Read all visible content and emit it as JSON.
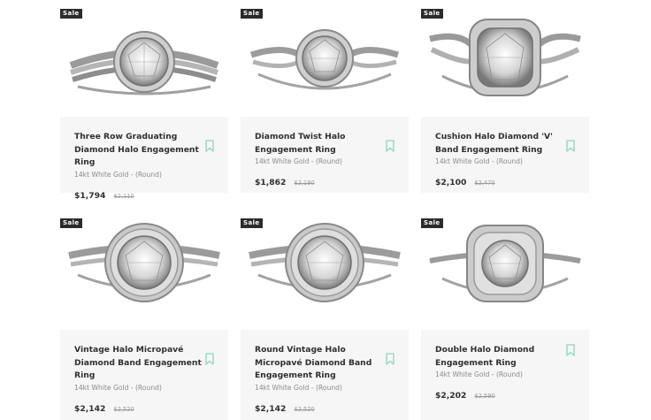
{
  "products": [
    {
      "sale": "Sale",
      "name": "Three Row Graduating Diamond Halo Engagement Ring",
      "metal": "14kt White Gold - (Round)",
      "price": "$1,794",
      "was": "$2,110"
    },
    {
      "sale": "Sale",
      "name": "Diamond Twist Halo Engagement Ring",
      "metal": "14kt White Gold - (Round)",
      "price": "$1,862",
      "was": "$2,190"
    },
    {
      "sale": "Sale",
      "name": "Cushion Halo Diamond 'V' Band Engagement Ring",
      "metal": "14kt White Gold - (Round)",
      "price": "$2,100",
      "was": "$2,470"
    },
    {
      "sale": "Sale",
      "name": "Vintage Halo Micropavé Diamond Band Engagement Ring",
      "metal": "14kt White Gold - (Round)",
      "price": "$2,142",
      "was": "$2,520"
    },
    {
      "sale": "Sale",
      "name": "Round Vintage Halo Micropavé Diamond Band Engagement Ring",
      "metal": "14kt White Gold - (Round)",
      "price": "$2,142",
      "was": "$2,520"
    },
    {
      "sale": "Sale",
      "name": "Double Halo Diamond Engagement Ring",
      "metal": "14kt White Gold - (Round)",
      "price": "$2,202",
      "was": "$2,590"
    }
  ],
  "colors": {
    "bookmark": "#9fdcc4",
    "card_bg": "#f6f6f6",
    "sale_badge": "#2b2b2b"
  },
  "icons": {
    "bookmark": "bookmark-outline-icon"
  }
}
